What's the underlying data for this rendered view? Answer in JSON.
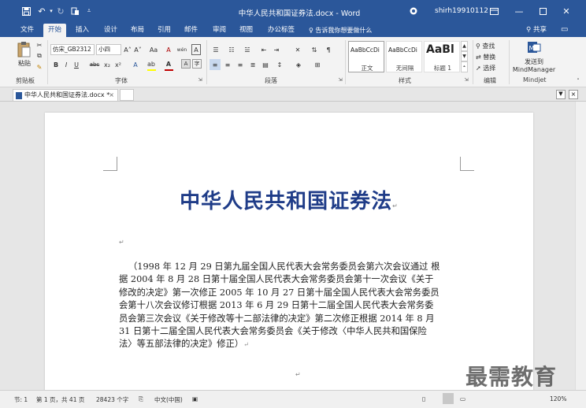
{
  "window": {
    "doc_title": "中华人民共和国证券法.docx - Word",
    "user": "shirh19910112"
  },
  "menu": {
    "tabs": [
      "文件",
      "开始",
      "插入",
      "设计",
      "布局",
      "引用",
      "邮件",
      "审阅",
      "视图",
      "办公标签"
    ],
    "tell_me": "告诉我你想要做什么",
    "share": "共享"
  },
  "ribbon": {
    "clipboard": {
      "paste": "粘贴",
      "label": "剪贴板"
    },
    "font": {
      "family": "仿宋_GB2312",
      "size": "小四",
      "label": "字体",
      "bold": "B",
      "italic": "I",
      "underline": "U",
      "strike": "abc",
      "sub": "x₂",
      "sup": "x²",
      "grow": "A˄",
      "shrink": "A˅",
      "case": "Aa",
      "clear": "A",
      "phonetic": "wén",
      "border": "A",
      "highlight_color": "#ffff00",
      "font_color": "#c00000"
    },
    "paragraph": {
      "label": "段落"
    },
    "styles": {
      "label": "样式",
      "items": [
        {
          "sample": "AaBbCcDi",
          "name": "正文"
        },
        {
          "sample": "AaBbCcDi",
          "name": "无间隔"
        },
        {
          "sample": "AaBl",
          "name": "标题 1"
        }
      ]
    },
    "editing": {
      "find": "查找",
      "replace": "替换",
      "select": "选择",
      "label": "编辑"
    },
    "mindjet": {
      "send": "发送到",
      "app": "MindManager",
      "label": "Mindjet"
    }
  },
  "doc_tab": {
    "name": "中华人民共和国证券法.docx *",
    "close": "×"
  },
  "document": {
    "heading": "中华人民共和国证券法",
    "paragraph_lines": [
      "（1998 年 12 月 29 日第九届全国人民代表大会常务委员会第六次会议通过  根",
      "据 2004 年 8 月 28 日第十届全国人民代表大会常务委员会第十一次会议《关于",
      "修改的决定》第一次修正 2005 年 10 月 27 日第十届全国人民代表大会常务委员",
      "会第十八次会议修订根据 2013 年 6 月 29 日第十二届全国人民代表大会常务委",
      "员会第三次会议《关于修改等十二部法律的决定》第二次修正根据 2014 年 8 月",
      "31 日第十二届全国人民代表大会常务委员会《关于修改〈中华人民共和国保险",
      "法〉等五部法律的决定》修正）"
    ],
    "para_mark": "↵"
  },
  "status": {
    "section": "节: 1",
    "page": "第 1 页，共 41 页",
    "words": "28423 个字",
    "language": "中文(中国)",
    "zoom": "120%"
  },
  "watermark": "最需教育",
  "colors": {
    "accent": "#2b579a",
    "heading": "#1f3c88"
  }
}
